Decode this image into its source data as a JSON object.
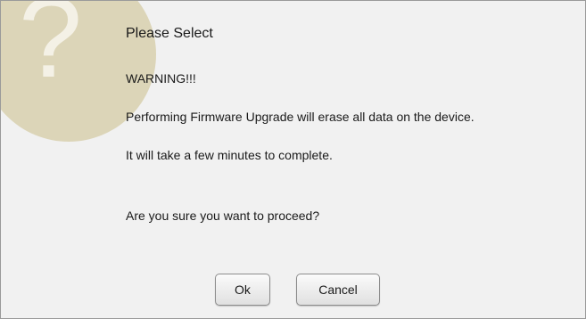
{
  "dialog": {
    "title": "Please Select",
    "icon": "question-mark-icon",
    "icon_glyph": "?",
    "messages": {
      "warning": "WARNING!!!",
      "line1": "Performing Firmware Upgrade will erase all data on the device.",
      "line2": "It will take a few minutes to complete.",
      "line3": "Are you sure you want to proceed?"
    },
    "buttons": {
      "ok": "Ok",
      "cancel": "Cancel"
    }
  },
  "colors": {
    "dialog_background": "#f1f1f1",
    "icon_circle": "#dcd5b8",
    "icon_glyph": "#f4f1e6"
  }
}
